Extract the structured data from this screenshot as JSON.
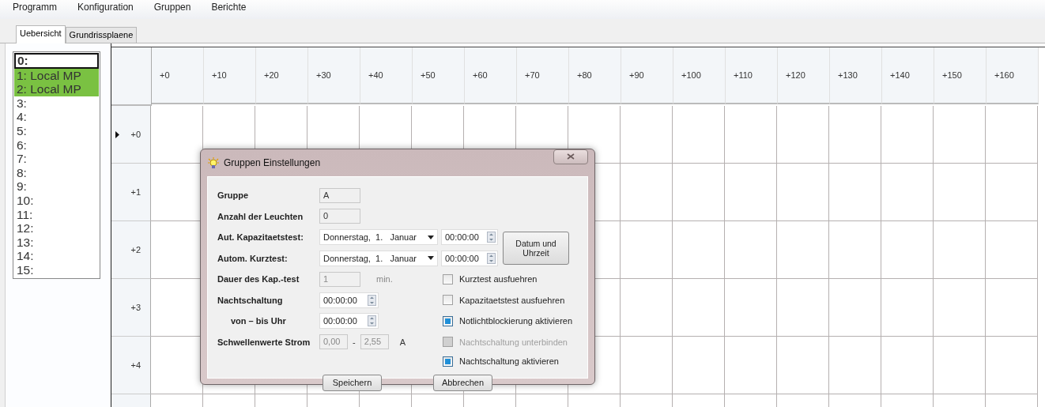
{
  "menu": [
    "Programm",
    "Konfiguration",
    "Gruppen",
    "Berichte"
  ],
  "tabs": [
    {
      "label": "Uebersicht",
      "selected": true
    },
    {
      "label": "Grundrissplaene",
      "selected": false
    }
  ],
  "group_list": [
    {
      "label": "0:",
      "focused": true,
      "highlighted": false
    },
    {
      "label": "1: Local MP",
      "focused": false,
      "highlighted": true
    },
    {
      "label": "2: Local MP",
      "focused": false,
      "highlighted": true
    },
    {
      "label": "3:",
      "focused": false,
      "highlighted": false
    },
    {
      "label": "4:",
      "focused": false,
      "highlighted": false
    },
    {
      "label": "5:",
      "focused": false,
      "highlighted": false
    },
    {
      "label": "6:",
      "focused": false,
      "highlighted": false
    },
    {
      "label": "7:",
      "focused": false,
      "highlighted": false
    },
    {
      "label": "8:",
      "focused": false,
      "highlighted": false
    },
    {
      "label": "9:",
      "focused": false,
      "highlighted": false
    },
    {
      "label": "10:",
      "focused": false,
      "highlighted": false
    },
    {
      "label": "11:",
      "focused": false,
      "highlighted": false
    },
    {
      "label": "12:",
      "focused": false,
      "highlighted": false
    },
    {
      "label": "13:",
      "focused": false,
      "highlighted": false
    },
    {
      "label": "14:",
      "focused": false,
      "highlighted": false
    },
    {
      "label": "15:",
      "focused": false,
      "highlighted": false
    }
  ],
  "grid": {
    "columns": [
      "+0",
      "+10",
      "+20",
      "+30",
      "+40",
      "+50",
      "+60",
      "+70",
      "+80",
      "+90",
      "+100",
      "+110",
      "+120",
      "+130",
      "+140",
      "+150",
      "+160"
    ],
    "rows": [
      {
        "label": "+0",
        "current": true
      },
      {
        "label": "+1",
        "current": false
      },
      {
        "label": "+2",
        "current": false
      },
      {
        "label": "+3",
        "current": false
      },
      {
        "label": "+4",
        "current": false
      }
    ]
  },
  "dialog": {
    "title": "Gruppen Einstellungen",
    "fields": [
      {
        "kind": "readonly",
        "label": "Gruppe",
        "value": "A",
        "indented": false
      },
      {
        "kind": "readonly",
        "label": "Anzahl der Leuchten",
        "value": "0",
        "indented": false
      },
      {
        "kind": "datetime",
        "label": "Aut. Kapazitaetstest:",
        "date": "Donnerstag,  1.   Januar",
        "time": "00:00:00",
        "indented": false
      },
      {
        "kind": "datetime",
        "label": "Autom. Kurztest:",
        "date": "Donnerstag,  1.   Januar",
        "time": "00:00:00",
        "indented": false
      },
      {
        "kind": "unit",
        "label": "Dauer des Kap.-test",
        "value": "1",
        "unit": "min.",
        "disabled": true,
        "indented": false
      },
      {
        "kind": "time",
        "label": "Nachtschaltung",
        "value": "00:00:00",
        "indented": false
      },
      {
        "kind": "time",
        "label": "von – bis Uhr",
        "value": "00:00:00",
        "indented": true
      },
      {
        "kind": "range",
        "label": "Schwellenwerte Strom",
        "from": "0,00",
        "separator": "-",
        "to": "2,55",
        "unit": "A",
        "indented": false
      }
    ],
    "datetime_button": "Datum und Uhrzeit",
    "checkboxes": [
      {
        "label": "Kurztest ausfuehren",
        "checked": false,
        "disabled": false
      },
      {
        "label": "Kapazitaetstest ausfuehren",
        "checked": false,
        "disabled": false
      },
      {
        "label": "Notlichtblockierung aktivieren",
        "checked": true,
        "disabled": false
      },
      {
        "label": "Nachtschaltung unterbinden",
        "checked": false,
        "disabled": true
      },
      {
        "label": "Nachtschaltung aktivieren",
        "checked": true,
        "disabled": false
      }
    ],
    "buttons": [
      "Speichern",
      "Abbrechen"
    ]
  }
}
